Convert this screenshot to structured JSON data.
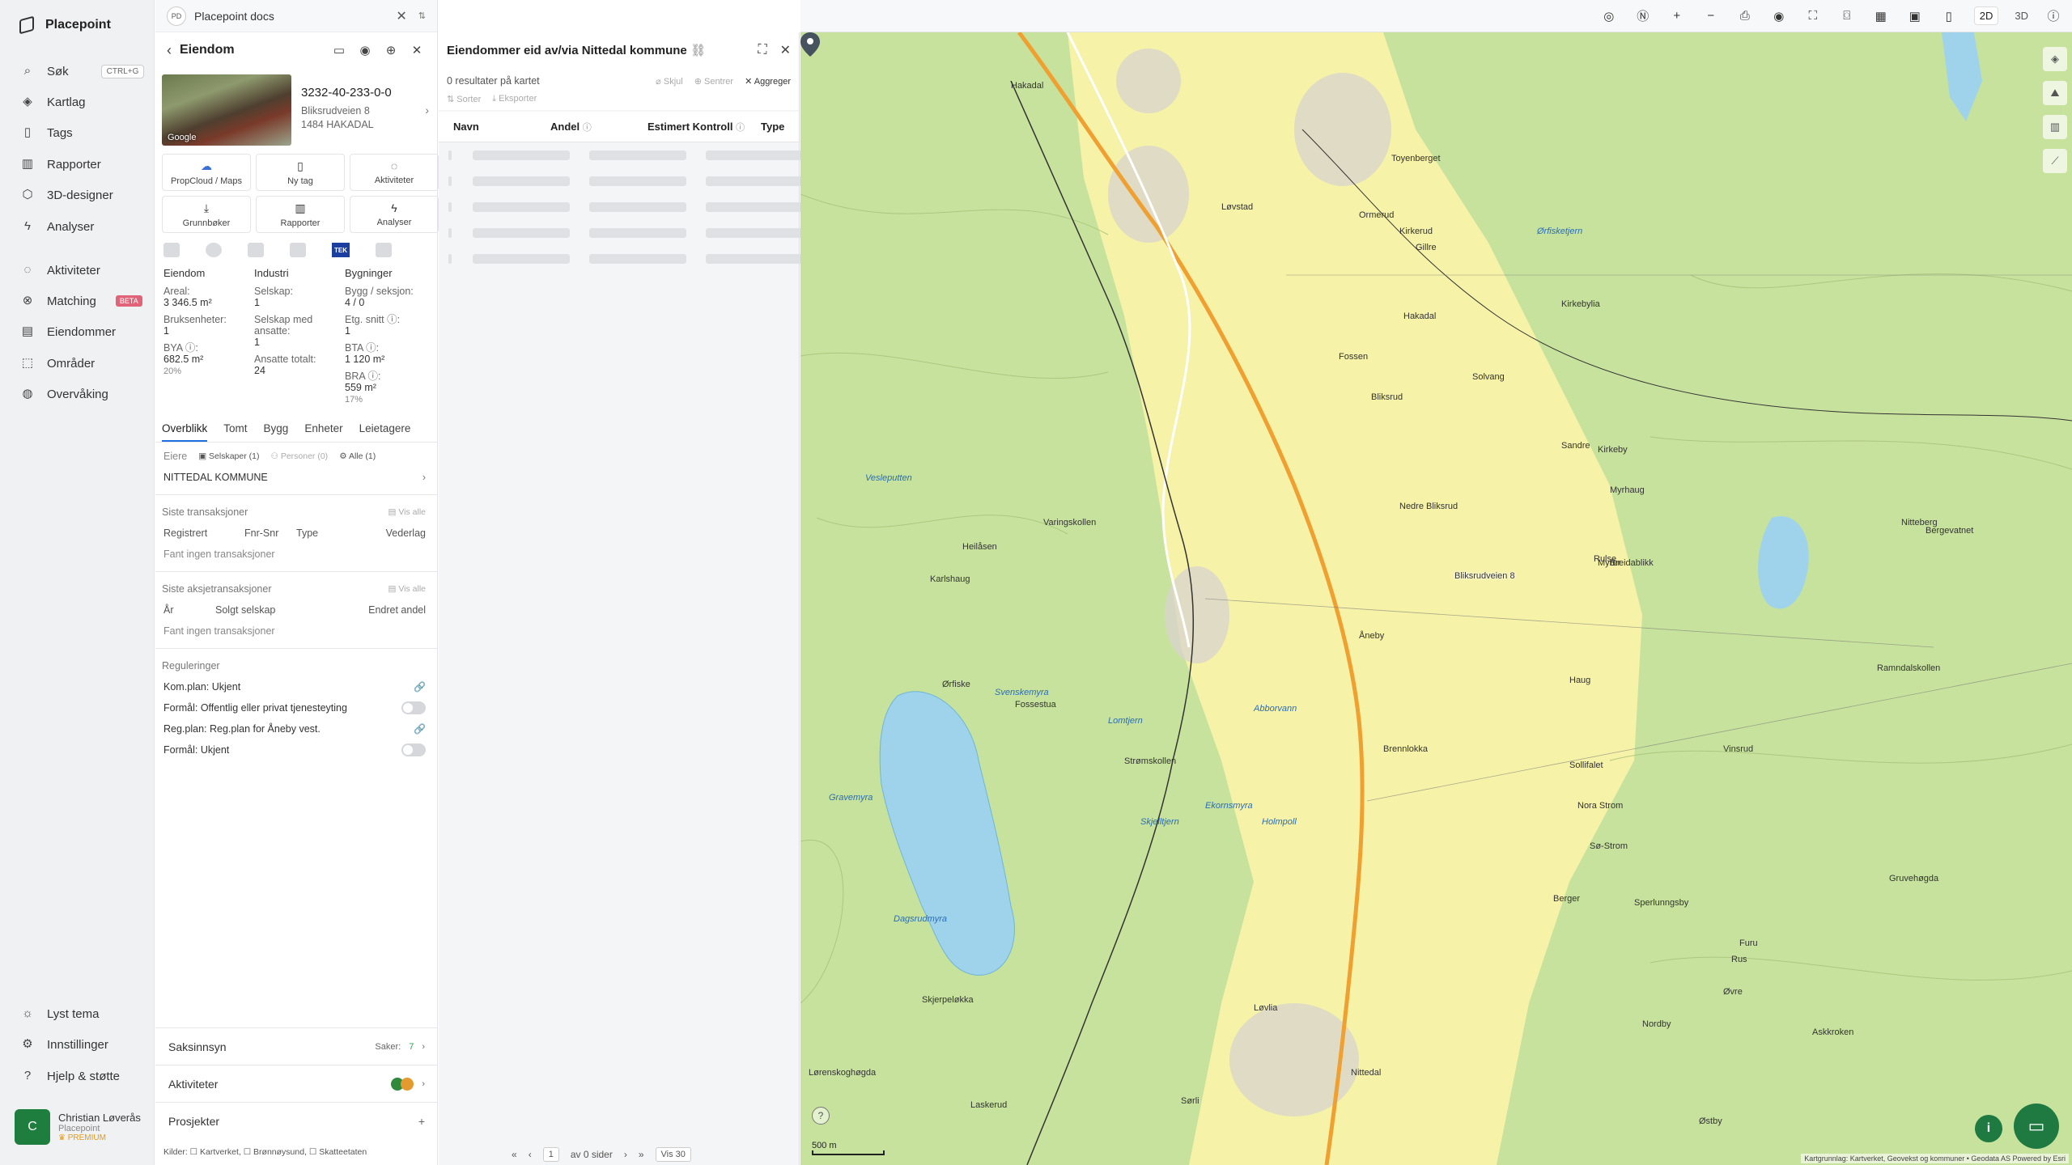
{
  "nav": {
    "brand": "Placepoint",
    "items": [
      {
        "label": "Søk",
        "icon": "search-icon",
        "kbd": "CTRL+G"
      },
      {
        "label": "Kartlag",
        "icon": "layers-icon"
      },
      {
        "label": "Tags",
        "icon": "bookmark-icon"
      },
      {
        "label": "Rapporter",
        "icon": "chart-icon"
      },
      {
        "label": "3D-designer",
        "icon": "cube-icon"
      },
      {
        "label": "Analyser",
        "icon": "bolt-icon"
      },
      {
        "label": "Aktiviteter",
        "icon": "chat-icon"
      },
      {
        "label": "Matching",
        "icon": "handshake-icon",
        "badge": "BETA"
      },
      {
        "label": "Eiendommer",
        "icon": "building-icon"
      },
      {
        "label": "Områder",
        "icon": "area-icon"
      },
      {
        "label": "Overvåking",
        "icon": "monitor-icon"
      }
    ],
    "bottom": [
      {
        "label": "Lyst tema",
        "icon": "sun-icon"
      },
      {
        "label": "Innstillinger",
        "icon": "gear-icon"
      },
      {
        "label": "Hjelp & støtte",
        "icon": "help-icon"
      }
    ],
    "user": {
      "initial": "C",
      "name": "Christian Løverås",
      "org": "Placepoint",
      "plan": "PREMIUM"
    }
  },
  "tab": {
    "badge": "PD",
    "title": "Placepoint docs"
  },
  "property": {
    "header": "Eiendom",
    "gid": "3232-40-233-0-0",
    "address1": "Bliksrudveien 8",
    "address2": "1484 HAKADAL",
    "photo_label": "Google",
    "actions": [
      "PropCloud / Maps",
      "Ny tag",
      "Aktiviteter",
      "Grunnbøker",
      "Rapporter",
      "Analyser"
    ],
    "tek": "TEK",
    "stats": {
      "col1_h": "Eiendom",
      "areal_l": "Areal:",
      "areal_v": "3 346.5 m²",
      "bruks_l": "Bruksenheter:",
      "bruks_v": "1",
      "bya_l": "BYA ⓘ:",
      "bya_v": "682.5 m²",
      "bya_p": "20%",
      "col2_h": "Industri",
      "selskap_l": "Selskap:",
      "selskap_v": "1",
      "ansatte_l": "Selskap med ansatte:",
      "ansatte_v": "1",
      "ansattetot_l": "Ansatte totalt:",
      "ansattetot_v": "24",
      "col3_h": "Bygninger",
      "bygg_l": "Bygg / seksjon:",
      "bygg_v": "4 / 0",
      "etg_l": "Etg. snitt ⓘ:",
      "etg_v": "1",
      "bta_l": "BTA ⓘ:",
      "bta_v": "1 120 m²",
      "bra_l": "BRA ⓘ:",
      "bra_v": "559 m²",
      "bra_p": "17%"
    },
    "subtabs": [
      "Overblikk",
      "Tomt",
      "Bygg",
      "Enheter",
      "Leietagere"
    ],
    "owners": {
      "label": "Eiere",
      "selskaper": "Selskaper (1)",
      "personer": "Personer (0)",
      "alle": "Alle (1)",
      "owner": "NITTEDAL KOMMUNE"
    },
    "transactions": {
      "title": "Siste transaksjoner",
      "vis_alle": "Vis alle",
      "cols": [
        "Registrert",
        "Fnr-Snr",
        "Type",
        "Vederlag"
      ],
      "empty": "Fant ingen transaksjoner"
    },
    "share_transactions": {
      "title": "Siste aksjetransaksjoner",
      "vis_alle": "Vis alle",
      "cols": [
        "År",
        "Solgt selskap",
        "Endret andel"
      ],
      "empty": "Fant ingen transaksjoner"
    },
    "regulations": {
      "title": "Reguleringer",
      "items": [
        "Kom.plan: Ukjent",
        "Formål: Offentlig eller privat tjenesteyting",
        "Reg.plan: Reg.plan for Åneby vest.",
        "Formål: Ukjent"
      ]
    },
    "bottom": {
      "saksinnsyn": "Saksinnsyn",
      "saker": "Saker:",
      "saker_count": "7",
      "aktiviteter": "Aktiviteter",
      "prosjekter": "Prosjekter"
    },
    "kilder": "Kilder: ☐ Kartverket, ☐ Brønnøysund, ☐ Skatteetaten"
  },
  "owned": {
    "title": "Eiendommer eid av/via Nittedal kommune",
    "results": "0 resultater på kartet",
    "skjul": "Skjul",
    "sentrer": "Sentrer",
    "aggreger": "Aggreger",
    "sorter": "Sorter",
    "eksporter": "Eksporter",
    "columns": [
      "Navn",
      "Andel",
      "Estimert Kontroll",
      "Type"
    ],
    "pager": {
      "page": "1",
      "of": "av 0 sider",
      "vis": "Vis 30"
    }
  },
  "map": {
    "mode_2d": "2D",
    "mode_3d": "3D",
    "scale": "500 m",
    "attribution": "Kartgrunnlag: Kartverket, Geovekst og kommuner • Geodata AS Powered by Esri",
    "pin_label": "Bliksrudveien 8",
    "places": [
      "Hakadal",
      "Toyenberget",
      "Ormerud",
      "Løvstad",
      "Kirkerud",
      "Kirkebylia",
      "Gillre",
      "Hakadal",
      "Solvang",
      "Fossen",
      "Bliksrud",
      "Sandre",
      "Kirkeby",
      "Myrhaug",
      "Nedre Bliksrud",
      "Rulse",
      "Myrer",
      "Breidablikk",
      "Åneby",
      "Haug",
      "Varingskollen",
      "Heilåsen",
      "Karlshaug",
      "Ørfiske",
      "Fossestua",
      "Brennlokka",
      "Sollifalet",
      "Nora Strom",
      "Sø-Strom",
      "Gruvehøgda",
      "Ramndalskollen",
      "Nitteberg",
      "Vinsrud",
      "Strømskollen",
      "Furu",
      "Berger",
      "Sperlunngsby",
      "Rus",
      "Øvre",
      "Nordby",
      "Askkroken",
      "Nittedal",
      "Skjerpeløkka",
      "Løvlia",
      "Laskerud",
      "Sørli",
      "Lørenskoghøgda",
      "Østby",
      "Bergevatnet"
    ],
    "waters": [
      "Svenskemyra",
      "Lomtjern",
      "Abborvann",
      "Skjelltjern",
      "Holmpoll",
      "Gravemyra",
      "Dagsrudmyra",
      "Ørfisketjern",
      "Ekornsmyra",
      "Vesleputten"
    ]
  }
}
